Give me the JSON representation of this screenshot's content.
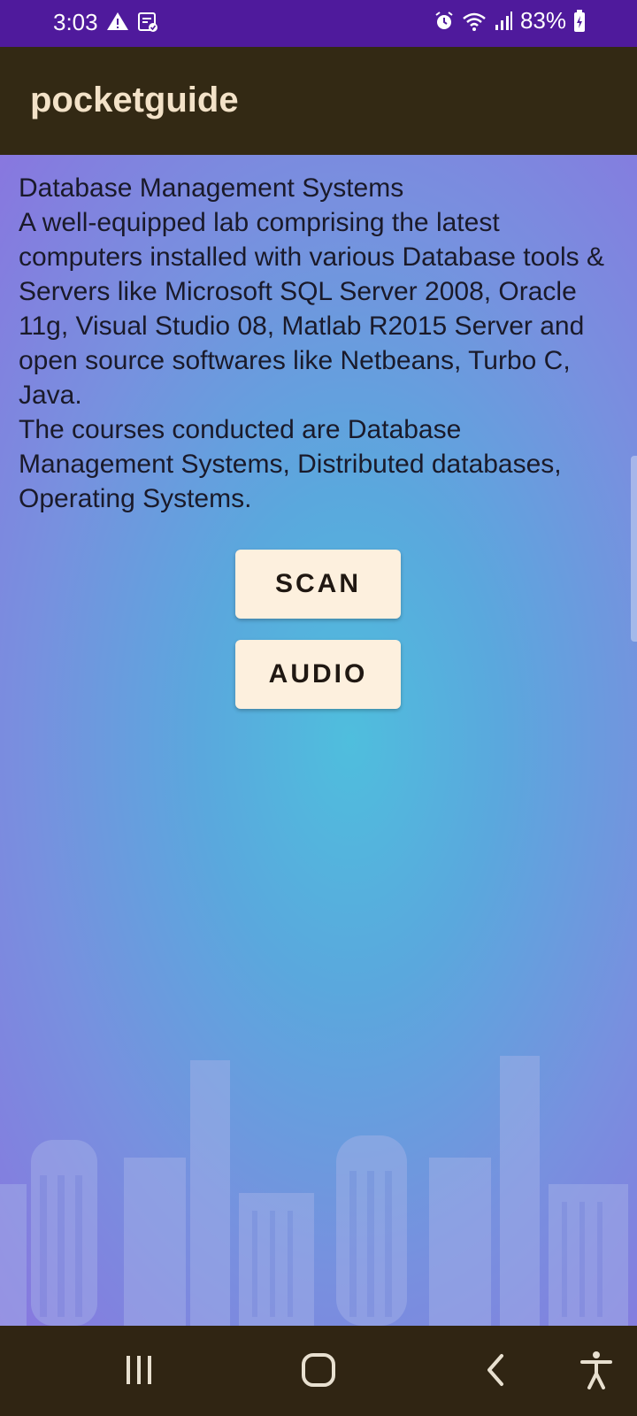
{
  "status_bar": {
    "time": "3:03",
    "battery": "83%",
    "left_icons": [
      "warning-icon",
      "clipboard-check-icon"
    ],
    "right_icons": [
      "alarm-icon",
      "wifi-icon",
      "signal-icon",
      "battery-charging-icon"
    ]
  },
  "app_bar": {
    "title": "pocketguide"
  },
  "content": {
    "description": "Database Management Systems\nA well-equipped lab comprising the latest computers installed with various Database tools & Servers like Microsoft SQL Server 2008, Oracle 11g, Visual Studio 08, Matlab R2015 Server and open source softwares like Netbeans, Turbo C, Java.\nThe courses conducted are Database Management Systems, Distributed databases, Operating Systems.",
    "scan_label": "SCAN",
    "audio_label": "AUDIO"
  },
  "nav_bar": {
    "buttons": [
      "recent-apps-icon",
      "home-icon",
      "back-icon",
      "accessibility-icon"
    ]
  },
  "colors": {
    "status_bar": "#4f1a9c",
    "app_bar": "#332914",
    "app_title": "#f3e2c8",
    "button_bg": "#fdf0de",
    "nav_bar": "#302513"
  }
}
